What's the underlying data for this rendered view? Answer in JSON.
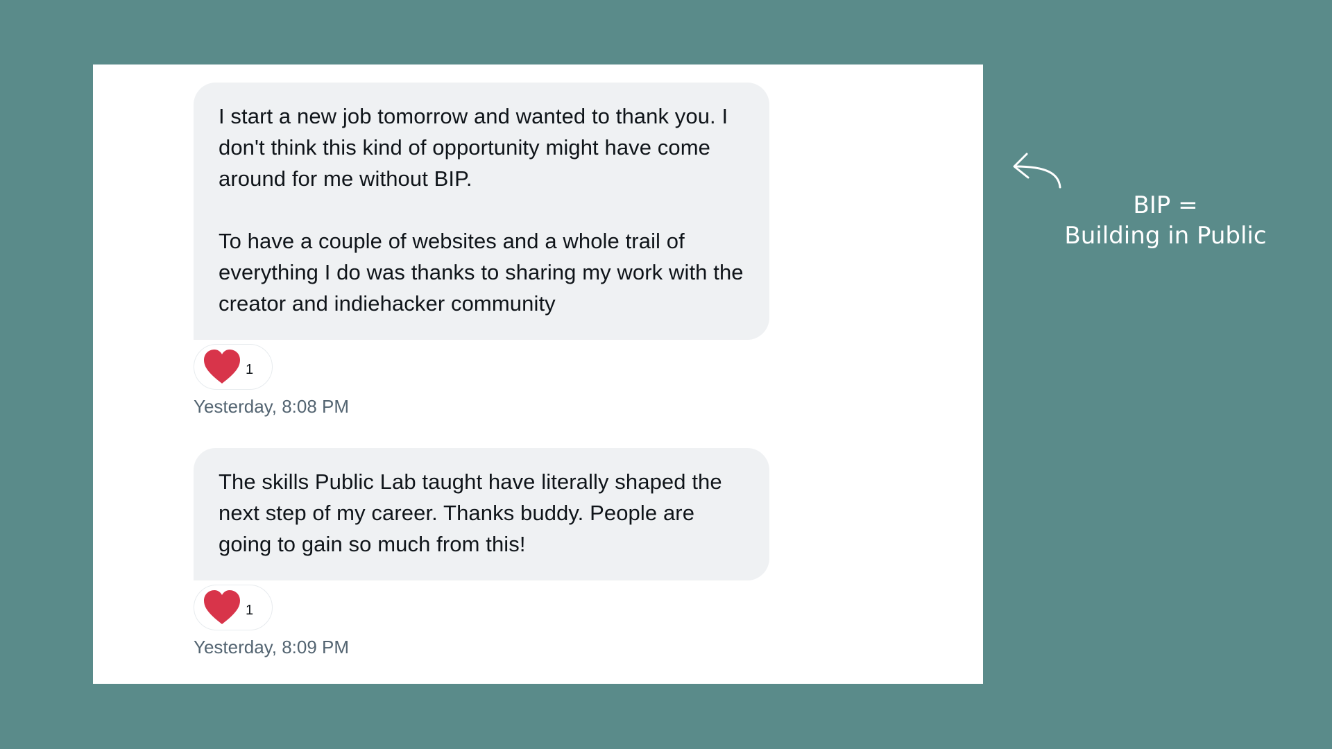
{
  "conversation": {
    "messages": [
      {
        "paragraphs": [
          "I start a new job tomorrow and wanted to thank you. I don't think this kind of opportunity might have come around for me without BIP.",
          "To have a couple of websites and a whole trail of everything I do was thanks to sharing my work with the creator and indiehacker community"
        ],
        "reaction": {
          "icon": "heart-icon",
          "count": "1"
        },
        "timestamp": "Yesterday, 8:08 PM"
      },
      {
        "paragraphs": [
          "The skills Public Lab taught have literally shaped the next step of my career. Thanks buddy. People are going to gain so much from this!"
        ],
        "reaction": {
          "icon": "heart-icon",
          "count": "1"
        },
        "timestamp": "Yesterday, 8:09 PM"
      }
    ]
  },
  "annotation": {
    "line1": "BIP =",
    "line2": "Building in Public",
    "icon": "curved-arrow-icon"
  },
  "colors": {
    "background": "#5a8b8a",
    "bubble": "#eff1f3",
    "heart": "#d8344a",
    "timestamp": "#536471"
  }
}
